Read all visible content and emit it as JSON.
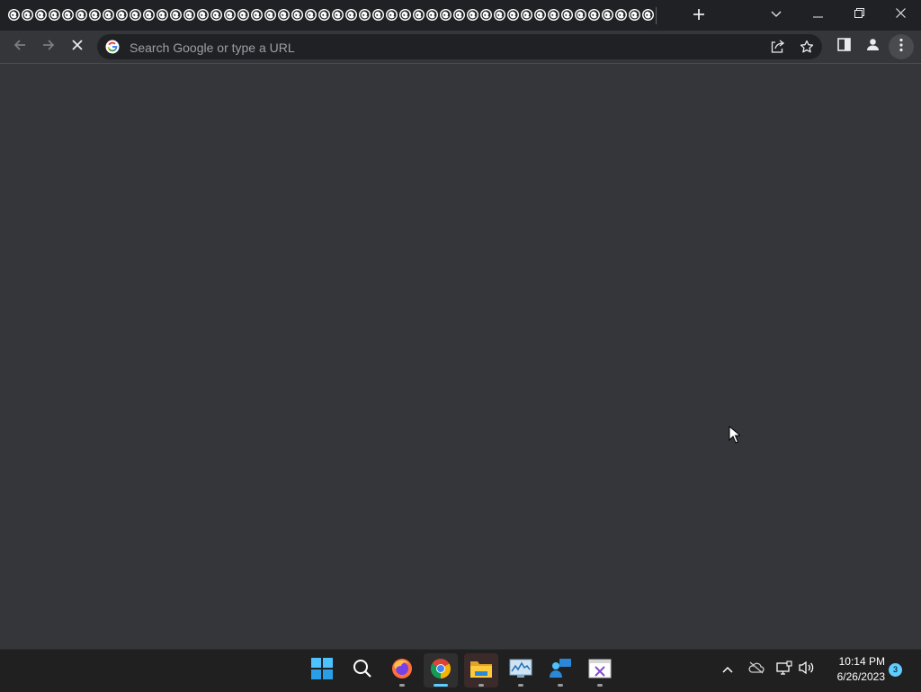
{
  "browser": {
    "tab_count": 48,
    "tab_icon": "loading-globe-icon",
    "new_tab_icon": "plus-icon",
    "caption_buttons": [
      "tab-search-icon",
      "minimize-icon",
      "restore-icon",
      "close-icon"
    ]
  },
  "toolbar": {
    "back_icon": "arrow-left-icon",
    "forward_icon": "arrow-right-icon",
    "stop_icon": "stop-x-icon",
    "omnibox": {
      "placeholder": "Search Google or type a URL",
      "value": "",
      "search_engine_icon": "google-g-icon"
    },
    "actions": [
      "share-icon",
      "bookmark-star-icon",
      "side-panel-icon",
      "profile-icon",
      "menu-kebab-icon"
    ]
  },
  "page": {
    "background": "#35363a",
    "cursor_icon": "mouse-pointer-icon"
  },
  "taskbar": {
    "apps": [
      {
        "name": "start",
        "icon": "windows-start-icon"
      },
      {
        "name": "search",
        "icon": "search-icon"
      },
      {
        "name": "firefox",
        "icon": "firefox-icon",
        "running": true
      },
      {
        "name": "chrome",
        "icon": "chrome-icon",
        "running": true,
        "focused": true
      },
      {
        "name": "file-explorer",
        "icon": "folder-icon",
        "running": true
      },
      {
        "name": "performance-monitor",
        "icon": "chart-monitor-icon",
        "running": true
      },
      {
        "name": "chat",
        "icon": "people-chat-icon",
        "running": true
      },
      {
        "name": "visual-studio-app",
        "icon": "visual-studio-icon",
        "running": true
      }
    ],
    "tray": {
      "icons": [
        "chevron-up-icon",
        "cloud-offline-icon",
        "network-icon",
        "volume-icon"
      ],
      "time": "10:14 PM",
      "date": "6/26/2023",
      "notification_count": "3"
    }
  },
  "colors": {
    "tabstrip": "#202124",
    "toolbar": "#35363a",
    "omnibox": "#202124",
    "taskbar": "#202020",
    "accent": "#60cdff"
  }
}
